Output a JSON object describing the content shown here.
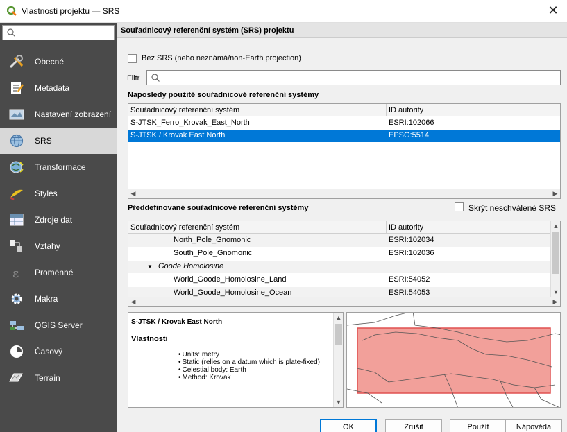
{
  "window": {
    "title": "Vlastnosti projektu — SRS",
    "close_glyph": "✕"
  },
  "sidebar": {
    "search_placeholder": "",
    "items": [
      {
        "label": "Obecné",
        "icon": "tools-icon"
      },
      {
        "label": "Metadata",
        "icon": "metadata-icon"
      },
      {
        "label": "Nastavení zobrazení",
        "icon": "view-settings-icon"
      },
      {
        "label": "SRS",
        "icon": "globe-icon"
      },
      {
        "label": "Transformace",
        "icon": "transform-icon"
      },
      {
        "label": "Styles",
        "icon": "styles-icon"
      },
      {
        "label": "Zdroje dat",
        "icon": "data-sources-icon"
      },
      {
        "label": "Vztahy",
        "icon": "relations-icon"
      },
      {
        "label": "Proměnné",
        "icon": "variables-icon"
      },
      {
        "label": "Makra",
        "icon": "macros-icon"
      },
      {
        "label": "QGIS Server",
        "icon": "server-icon"
      },
      {
        "label": "Časový",
        "icon": "clock-icon"
      },
      {
        "label": "Terrain",
        "icon": "terrain-icon"
      }
    ],
    "active_index": 3
  },
  "main": {
    "header": "Souřadnicový referenční systém (SRS) projektu",
    "no_srs_label": "Bez SRS (nebo neznámá/non-Earth projection)",
    "filter_label": "Filtr",
    "filter_value": "",
    "recent_title": "Naposledy použité souřadnicové referenční systémy",
    "columns": {
      "system": "Souřadnicový referenční systém",
      "authority": "ID autority"
    },
    "recent_rows": [
      {
        "name": "S-JTSK_Ferro_Krovak_East_North",
        "id": "ESRI:102066",
        "selected": false
      },
      {
        "name": "S-JTSK / Krovak East North",
        "id": "EPSG:5514",
        "selected": true
      }
    ],
    "predefined_title": "Předdefinované souřadnicové referenční systémy",
    "hide_deprecated_label": "Skrýt neschválené SRS",
    "predefined_rows": [
      {
        "name": "North_Pole_Gnomonic",
        "id": "ESRI:102034",
        "group": false
      },
      {
        "name": "South_Pole_Gnomonic",
        "id": "ESRI:102036",
        "group": false
      },
      {
        "name": "Goode Homolosine",
        "id": "",
        "group": true
      },
      {
        "name": "World_Goode_Homolosine_Land",
        "id": "ESRI:54052",
        "group": false
      },
      {
        "name": "World_Goode_Homolosine_Ocean",
        "id": "ESRI:54053",
        "group": false
      }
    ],
    "description": {
      "name": "S-JTSK / Krovak East North",
      "properties_title": "Vlastnosti",
      "properties": [
        "Units: metry",
        "Static (relies on a datum which is plate-fixed)",
        "Celestial body: Earth",
        "Method: Krovak"
      ]
    },
    "map": {
      "extent_color": "#f2a09a",
      "extent_border": "#e05050"
    }
  },
  "buttons": {
    "ok": "OK",
    "cancel": "Zrušit",
    "apply": "Použít",
    "help": "Nápověda"
  }
}
